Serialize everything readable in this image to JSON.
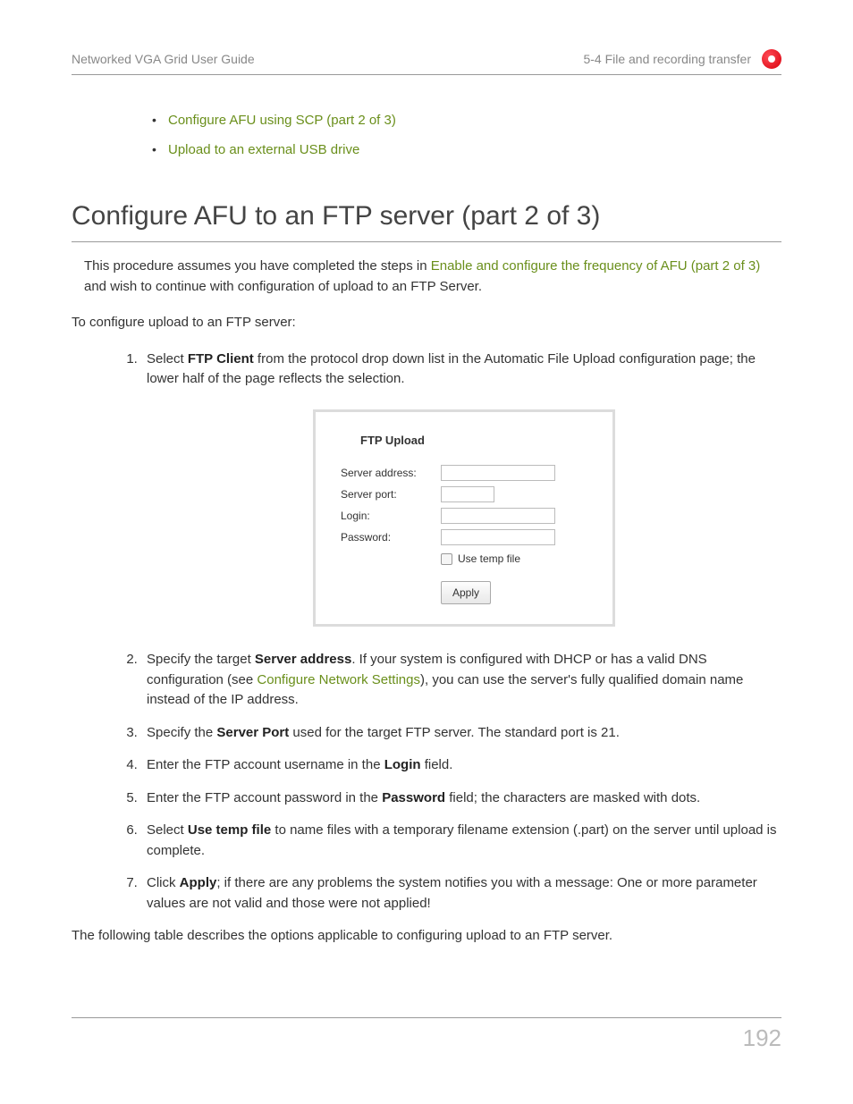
{
  "header": {
    "left": "Networked VGA Grid User Guide",
    "right": "5-4 File and recording transfer"
  },
  "top_links": [
    "Configure AFU using SCP (part 2 of 3)",
    "Upload to an external USB drive"
  ],
  "title": "Configure AFU to an FTP server (part 2 of 3)",
  "intro": {
    "pre": "This procedure assumes you have completed the steps in ",
    "link": "Enable and configure the frequency of AFU (part 2 of 3)",
    "post": " and wish to continue with configuration of upload to an FTP Server."
  },
  "lead": "To configure upload to an FTP server:",
  "steps": {
    "s1_pre": "Select ",
    "s1_bold": "FTP Client",
    "s1_post": " from the protocol drop down list in the Automatic File Upload configuration page; the lower half of the page reflects the selection.",
    "s2_pre": "Specify the target ",
    "s2_bold": "Server address",
    "s2_mid": ". If your system is configured with DHCP or has a valid DNS configuration (see ",
    "s2_link": "Configure Network Settings",
    "s2_post": "), you can use the server's fully qualified domain name instead of the IP address.",
    "s3_pre": "Specify the ",
    "s3_bold": "Server Port",
    "s3_post": " used for the target FTP server. The standard port is 21.",
    "s4_pre": "Enter the FTP account username in the ",
    "s4_bold": "Login",
    "s4_post": " field.",
    "s5_pre": "Enter the FTP account password in the ",
    "s5_bold": "Password",
    "s5_post": " field; the characters are masked with dots.",
    "s6_pre": "Select ",
    "s6_bold": "Use temp file",
    "s6_post": " to name files with a temporary filename extension (.part) on the server until upload is complete.",
    "s7_pre": "Click ",
    "s7_bold": "Apply",
    "s7_post": "; if there are any problems the system notifies you with a message: One or more parameter values are not valid and those were not applied!"
  },
  "figure": {
    "title": "FTP Upload",
    "server_address_label": "Server address:",
    "server_port_label": "Server port:",
    "login_label": "Login:",
    "password_label": "Password:",
    "use_temp_label": "Use temp file",
    "apply_label": "Apply"
  },
  "closing": "The following table describes the options applicable to configuring upload to an FTP server.",
  "page_number": "192"
}
